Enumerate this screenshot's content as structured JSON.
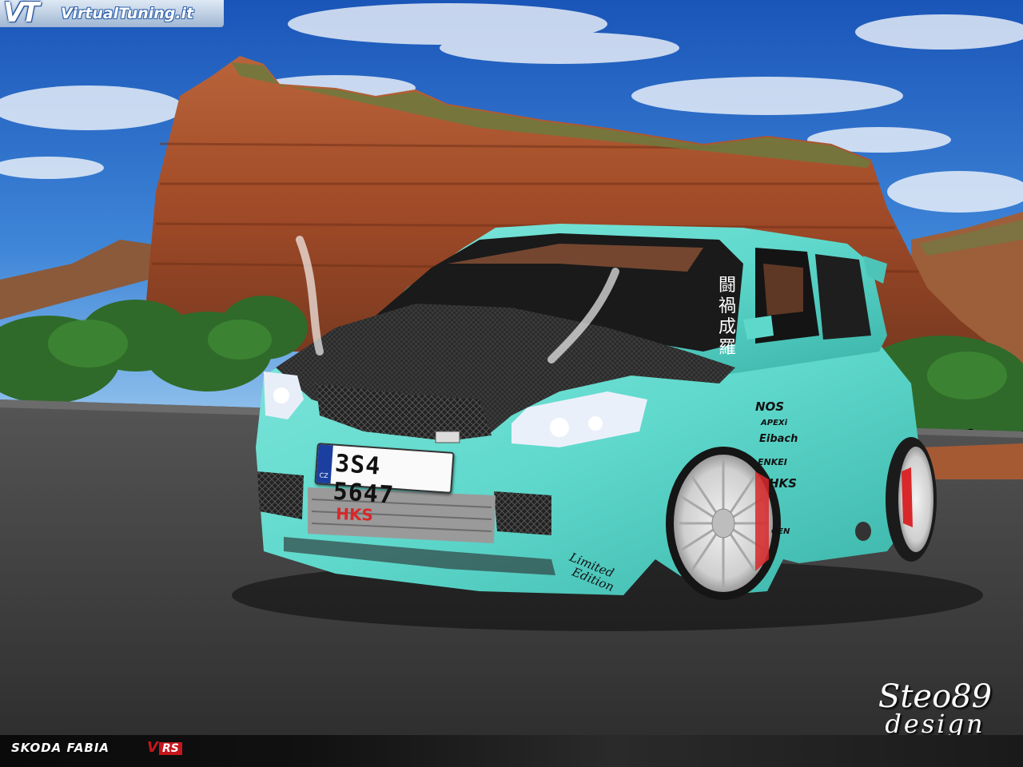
{
  "watermark": {
    "logo_mark": "VT",
    "logo_text": "VirtualTuning.it"
  },
  "vehicle": {
    "model_name": "SKODA FABIA",
    "model_badge_v": "V",
    "model_badge_rs": "RS",
    "license_plate": "3S4 5647",
    "plate_country": "CZ",
    "hood_decal": "HKS",
    "side_decals": [
      "NOS",
      "APEXi",
      "Eibach",
      "ENKEI",
      "HKS",
      "",
      "GEN"
    ],
    "window_kanji": [
      "闘",
      "禍",
      "成",
      "羅"
    ],
    "edition_script": [
      "Limited",
      "Edition"
    ],
    "colors": {
      "body": "#5fd8cc",
      "carbon": "#2a2a2a",
      "brake": "#d8282a",
      "rim": "#d8d8d8"
    }
  },
  "signature": {
    "line1": "Steo89",
    "line2": "design"
  }
}
